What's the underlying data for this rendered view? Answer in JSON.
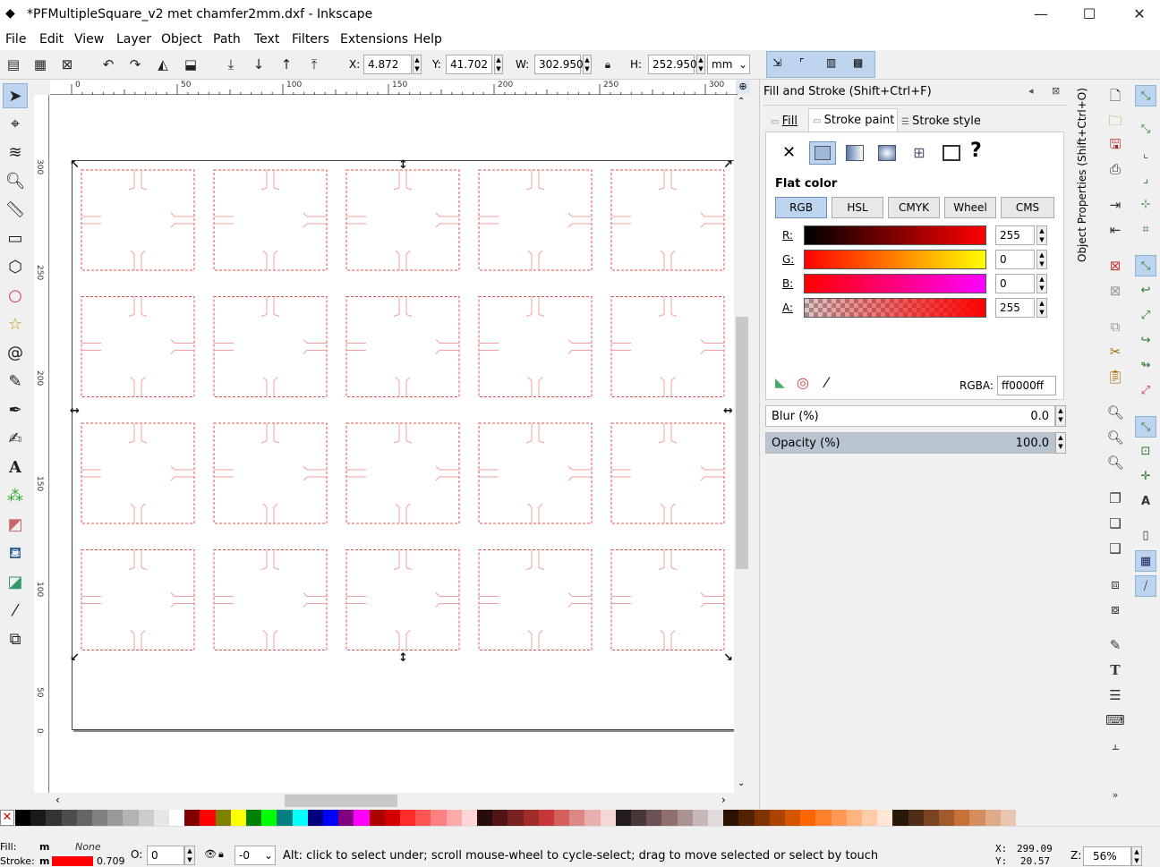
{
  "window": {
    "title": "*PFMultipleSquare_v2 met chamfer2mm.dxf - Inkscape",
    "min": "—",
    "max": "☐",
    "close": "✕"
  },
  "menu": [
    "File",
    "Edit",
    "View",
    "Layer",
    "Object",
    "Path",
    "Text",
    "Filters",
    "Extensions",
    "Help"
  ],
  "toolbar": {
    "x_label": "X:",
    "x": "4.872",
    "y_label": "Y:",
    "y": "41.702",
    "w_label": "W:",
    "w": "302.950",
    "h_label": "H:",
    "h": "252.950",
    "unit": "mm"
  },
  "ruler": {
    "top": [
      "0",
      "50",
      "100",
      "150",
      "200",
      "250",
      "300"
    ],
    "left": [
      "300",
      "250",
      "200",
      "150",
      "100",
      "50",
      "0"
    ]
  },
  "grid": {
    "rows": 4,
    "cols": 5,
    "stroke": "#e05050"
  },
  "panel": {
    "title": "Fill and Stroke (Shift+Ctrl+F)",
    "tab_fill": "Fill",
    "tab_stroke_paint": "Stroke paint",
    "tab_stroke_style": "Stroke style",
    "flat_color": "Flat color",
    "modes": [
      "RGB",
      "HSL",
      "CMYK",
      "Wheel",
      "CMS"
    ],
    "r_label": "R:",
    "g_label": "G:",
    "b_label": "B:",
    "a_label": "A:",
    "r": "255",
    "g": "0",
    "b": "0",
    "a": "255",
    "rgba_label": "RGBA:",
    "rgba": "ff0000ff",
    "blur_label": "Blur (%)",
    "blur": "0.0",
    "opacity_label": "Opacity (%)",
    "opacity": "100.0",
    "opacity_level": 1.0
  },
  "objprops_tab": "Object Properties (Shift+Ctrl+O)",
  "status": {
    "fill_label": "Fill:",
    "fill_value": "m",
    "stroke_label": "Stroke:",
    "stroke_value": "m",
    "none": "None",
    "stroke_width": "0.709",
    "o_label": "O:",
    "o_value": "0",
    "layer_value": "-0",
    "message": "Alt: click to select under; scroll mouse-wheel to cycle-select; drag to move selected or select by touch",
    "x_label": "X:",
    "x": "299.09",
    "y_label": "Y:",
    "y": "20.57",
    "z_label": "Z:",
    "zoom": "56%"
  },
  "palette": [
    "#000000",
    "#1a1a1a",
    "#333333",
    "#4d4d4d",
    "#666666",
    "#808080",
    "#999999",
    "#b3b3b3",
    "#cccccc",
    "#e6e6e6",
    "#ffffff",
    "#800000",
    "#ff0000",
    "#808000",
    "#ffff00",
    "#008000",
    "#00ff00",
    "#008080",
    "#00ffff",
    "#000080",
    "#0000ff",
    "#800080",
    "#ff00ff",
    "#aa0000",
    "#d40000",
    "#ff2a2a",
    "#ff5555",
    "#ff8080",
    "#ffaaaa",
    "#ffd5d5",
    "#280b0b",
    "#501616",
    "#782121",
    "#a02c2c",
    "#c83737",
    "#d35f5f",
    "#de8787",
    "#e9afaf",
    "#f4d7d7",
    "#241c1c",
    "#483737",
    "#6c5353",
    "#916f6f",
    "#ac9393",
    "#c8b7b7",
    "#e3dbdb",
    "#2b1100",
    "#552200",
    "#803300",
    "#aa4400",
    "#d45500",
    "#ff6600",
    "#ff7f2a",
    "#ff9955",
    "#ffb380",
    "#ffccaa",
    "#ffe6d5",
    "#28170b",
    "#502d16",
    "#784421",
    "#a05a2c",
    "#c87137",
    "#d38d5f",
    "#deaa87",
    "#e9c6af"
  ]
}
